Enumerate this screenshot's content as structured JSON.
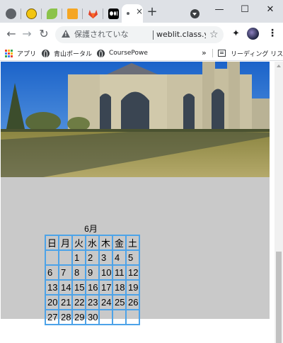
{
  "browser": {
    "tab_strip": {
      "close_glyph": "×",
      "newtab_glyph": "+",
      "window_buttons": {
        "minimize": "—",
        "maximize": "☐",
        "close": "✕"
      }
    },
    "toolbar": {
      "back_glyph": "←",
      "forward_glyph": "→",
      "reload_glyph": "↻",
      "security_label": "保護されていな",
      "url": "weblit.class.ysklab....",
      "star_glyph": "☆",
      "extensions_glyph": "✦",
      "menu_glyph": "⋮"
    },
    "bookmarks": {
      "apps_label": "アプリ",
      "items": [
        "青山ポータル",
        "CoursePowe"
      ],
      "overflow_glyph": "»",
      "reading_list_label": "リーディング リスト"
    },
    "icons": {
      "tab1": "globe-icon",
      "tab2": "smiley-favicon-icon",
      "tab3": "leaf-favicon-icon",
      "tab4": "k-favicon-icon",
      "tab5": "gitlab-fox-icon",
      "tab6": "medium-favicon-icon",
      "tab7": "page-favicon-icon"
    }
  },
  "page": {
    "hero_image_alt": "campus chapel building under blue sky",
    "calendar": {
      "title": "6月",
      "weekdays": [
        "日",
        "月",
        "火",
        "水",
        "木",
        "金",
        "土"
      ],
      "weeks": [
        [
          "",
          "",
          "1",
          "2",
          "3",
          "4",
          "5"
        ],
        [
          "6",
          "7",
          "8",
          "9",
          "10",
          "11",
          "12"
        ],
        [
          "13",
          "14",
          "15",
          "16",
          "17",
          "18",
          "19"
        ],
        [
          "20",
          "21",
          "22",
          "23",
          "24",
          "25",
          "26"
        ],
        [
          "27",
          "28",
          "29",
          "30",
          "",
          "",
          ""
        ]
      ],
      "border_color": "#4da3e8"
    },
    "background_color": "#c9c9c9"
  }
}
